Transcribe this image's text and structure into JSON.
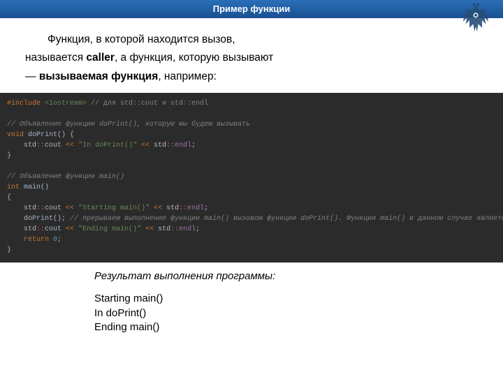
{
  "header": {
    "title": "Пример функции"
  },
  "intro": {
    "line1": "Функция, в которой находится вызов,",
    "line2a": "называется ",
    "caller": "caller",
    "line2b": ", а функция, которую вызывают",
    "line3a": "— ",
    "callee": "вызываемая функция",
    "line3b": ", например:"
  },
  "code": {
    "l1_inc": "#include ",
    "l1_hdr": "<iostream>",
    "l1_cmt": " // для std::cout и std::endl",
    "l3_cmt": "// Объявление функции doPrint(), которую мы будем вызывать",
    "l4_a": "void",
    "l4_b": " doPrint",
    "l4_c": "() {",
    "l5_std": "    std",
    "l5_cc": "::",
    "l5_cout": "cout ",
    "l5_op": "<< ",
    "l5_str": "\"In doPrint()\"",
    "l5_sp": " ",
    "l5_op2": "<< ",
    "l5_endl": "std",
    "l5_cc2": "::",
    "l5_e": "endl",
    "l5_semi": ";",
    "l6": "}",
    "l8_cmt": "// Объявление функции main()",
    "l9_a": "int",
    "l9_b": " main",
    "l9_c": "()",
    "l10": "{",
    "l11_std": "    std",
    "l11_cc": "::",
    "l11_cout": "cout ",
    "l11_op": "<< ",
    "l11_str": "\"Starting main()\"",
    "l11_op2": " << ",
    "l11_e_std": "std",
    "l11_cc2": "::",
    "l11_endl": "endl",
    "l11_semi": ";",
    "l12_call": "    doPrint();",
    "l12_cmt": " // прерываем выполнение функции main() вызовом функции doPrint(). Функция main() в данном случае является caller",
    "l13_std": "    std",
    "l13_cc": "::",
    "l13_cout": "cout ",
    "l13_op": "<< ",
    "l13_str": "\"Ending main()\"",
    "l13_op2": " << ",
    "l13_e_std": "std",
    "l13_cc2": "::",
    "l13_endl": "endl",
    "l13_semi": ";",
    "l14_ret": "    return ",
    "l14_zero": "0",
    "l14_semi": ";",
    "l15": "}"
  },
  "result": {
    "title": "Результат выполнения программы:",
    "line1": "Starting main()",
    "line2": "In doPrint()",
    "line3": "Ending main()"
  }
}
